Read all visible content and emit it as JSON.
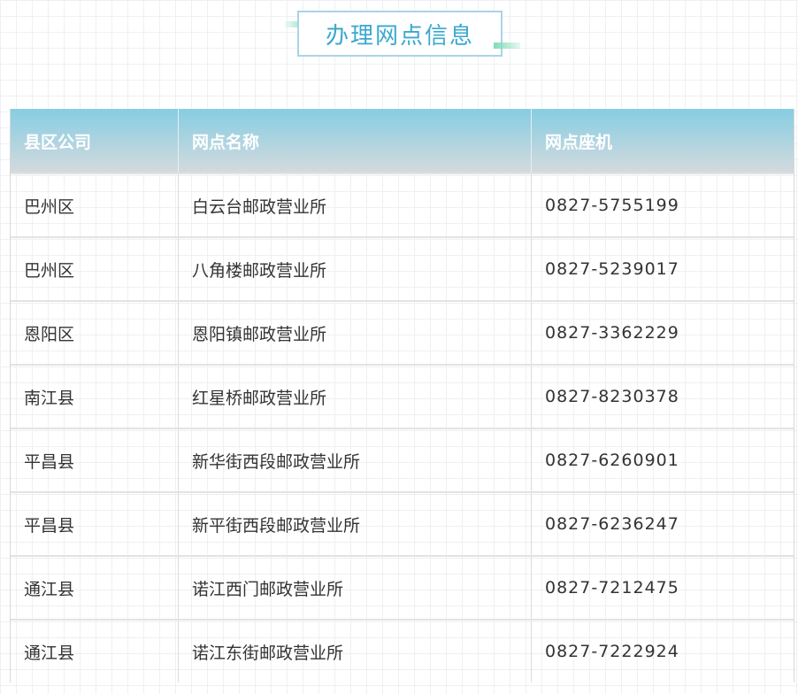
{
  "title": "办理网点信息",
  "table": {
    "headers": [
      "县区公司",
      "网点名称",
      "网点座机"
    ],
    "rows": [
      [
        "巴州区",
        "白云台邮政营业所",
        "0827-5755199"
      ],
      [
        "巴州区",
        "八角楼邮政营业所",
        "0827-5239017"
      ],
      [
        "恩阳区",
        "恩阳镇邮政营业所",
        "0827-3362229"
      ],
      [
        "南江县",
        "红星桥邮政营业所",
        "0827-8230378"
      ],
      [
        "平昌县",
        "新华街西段邮政营业所",
        "0827-6260901"
      ],
      [
        "平昌县",
        "新平街西段邮政营业所",
        "0827-6236247"
      ],
      [
        "通江县",
        "诺江西门邮政营业所",
        "0827-7212475"
      ],
      [
        "通江县",
        "诺江东街邮政营业所",
        "0827-7222924"
      ]
    ]
  },
  "colors": {
    "title_text": "#3aa8cf",
    "title_border": "#a9d4e8",
    "header_gradient_top": "#86cde3",
    "header_gradient_bottom": "#d4dadd",
    "accent_deco": "#7fdcb7"
  }
}
